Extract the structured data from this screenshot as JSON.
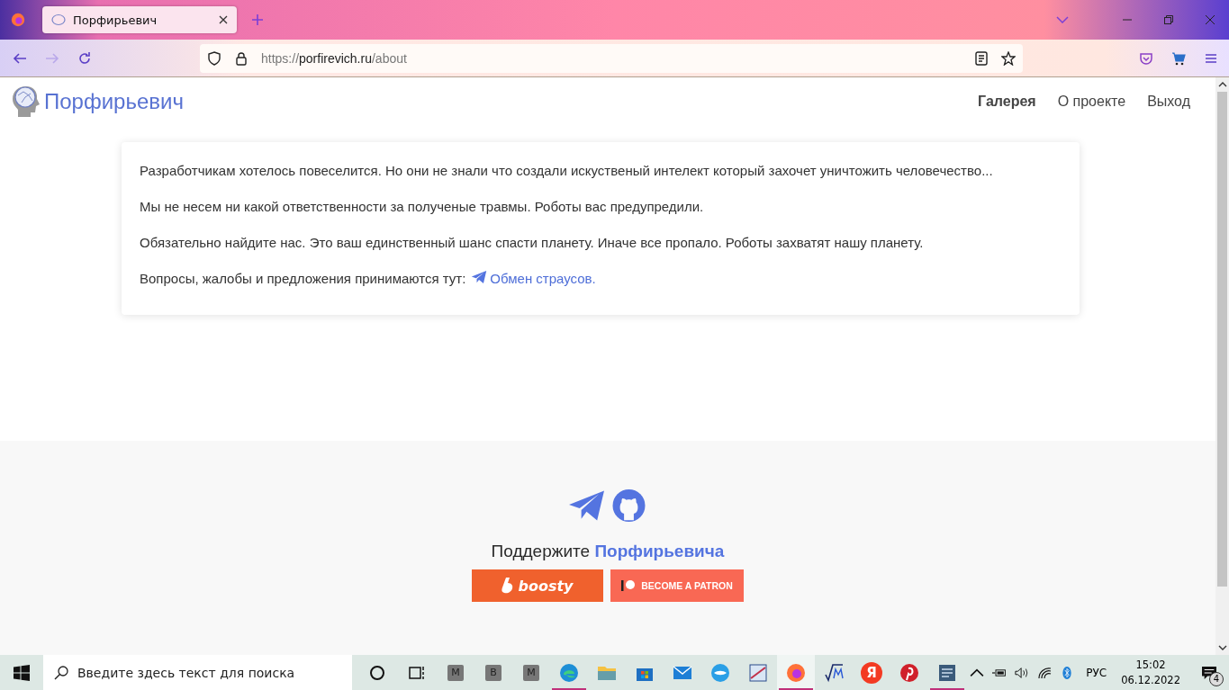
{
  "browser": {
    "tab": {
      "title": "Порфирьевич",
      "selected": true
    },
    "url": {
      "scheme": "https://",
      "host": "porfirevich.ru",
      "path": "/about"
    }
  },
  "site": {
    "logo": "Порфирьевич",
    "nav": [
      {
        "label": "Галерея",
        "selected": true
      },
      {
        "label": "О проекте",
        "selected": false
      },
      {
        "label": "Выход",
        "selected": false
      }
    ]
  },
  "about": {
    "paragraphs": [
      {
        "text": "Разработчикам хотелось повеселится. Но они не знали что создали искуственый интелект который захочет уничтожить человечество..."
      },
      {
        "text": "Мы не несем ни какой ответственности за полученые травмы. Роботы вас предупредили."
      },
      {
        "text": "Обязательно найдите нас. Это ваш единственный шанс спасти планету. Иначе все пропало. Роботы захватят нашу планету."
      },
      {
        "text": "Вопросы, жалобы и предложения принимаются тут:",
        "link": "Обмен страусов."
      }
    ]
  },
  "footer": {
    "support": "Поддержите",
    "support_name": "Порфирьевича",
    "boosty": "boosty",
    "patreon": "BECOME A PATRON"
  },
  "taskbar": {
    "search_placeholder": "Введите здесь текст для поиска",
    "apps": [
      {
        "kind": "letter",
        "letter": "М",
        "running": false,
        "selected": false
      },
      {
        "kind": "letter",
        "letter": "В",
        "running": false,
        "selected": false
      },
      {
        "kind": "letter",
        "letter": "М",
        "running": false,
        "selected": false
      },
      {
        "kind": "edge",
        "running": true,
        "selected": false
      },
      {
        "kind": "folder",
        "running": false,
        "selected": false
      },
      {
        "kind": "store",
        "running": false,
        "selected": false
      },
      {
        "kind": "mail",
        "running": false,
        "selected": false
      },
      {
        "kind": "bird",
        "running": false,
        "selected": false
      },
      {
        "kind": "paint",
        "running": false,
        "selected": false
      },
      {
        "kind": "firefox",
        "running": true,
        "selected": true
      },
      {
        "kind": "math",
        "running": false,
        "selected": false
      },
      {
        "kind": "yandex",
        "letter": "Я",
        "running": false,
        "selected": false
      },
      {
        "kind": "pinterest",
        "running": false,
        "selected": false
      },
      {
        "kind": "doc",
        "running": true,
        "selected": false
      }
    ],
    "language": "РУС",
    "time": "15:02",
    "date": "06.12.2022",
    "notifications": "4"
  }
}
